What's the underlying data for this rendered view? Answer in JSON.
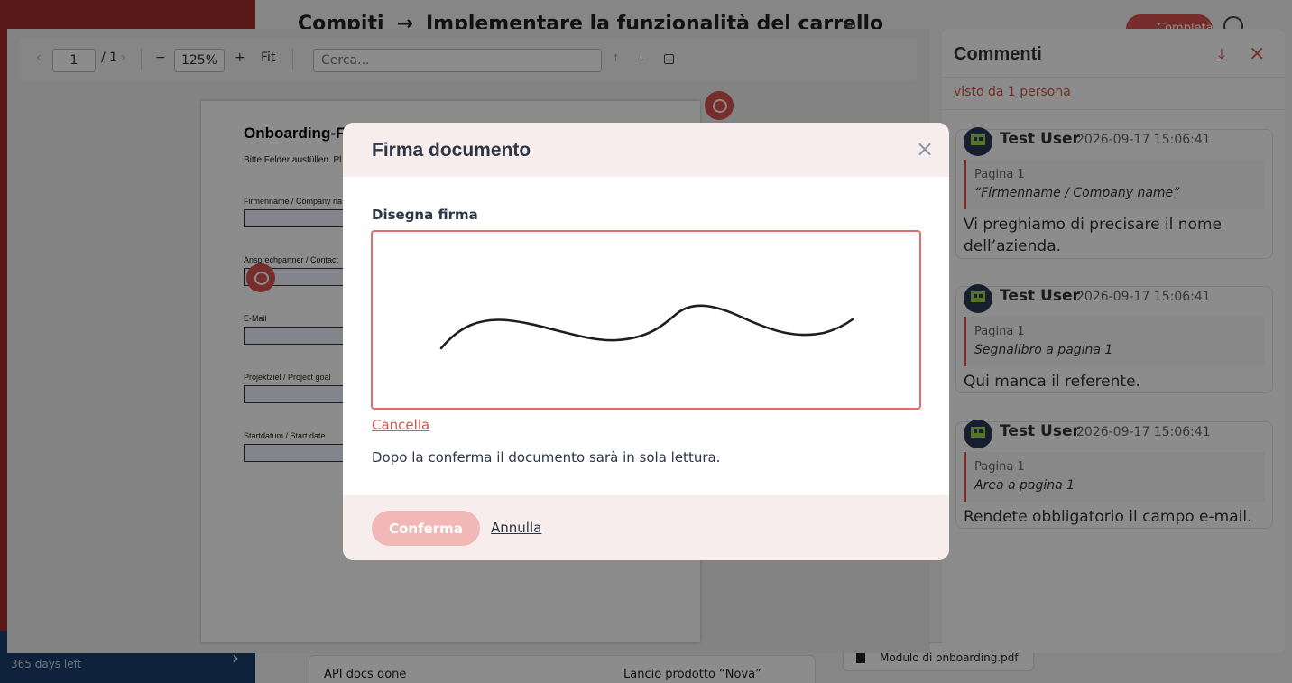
{
  "background": {
    "breadcrumb_parent": "Compiti",
    "breadcrumb_arrow": "→",
    "breadcrumb_current": "Implementare la funzionalità del carrello",
    "complete_label": "Completa",
    "trial_text": "365 days left",
    "task_left": "API docs done",
    "task_right": "Lancio prodotto “Nova”",
    "file_name": "Modulo di onboarding.pdf"
  },
  "toolbar": {
    "prev": "‹",
    "page_value": "1",
    "page_total": "/ 1",
    "next": "›",
    "zoom_out": "−",
    "zoom_value": "125%",
    "zoom_in": "+",
    "fit_label": "Fit",
    "search_placeholder": "Cerca...",
    "search_prev": "↑",
    "search_next": "↓"
  },
  "pdf": {
    "title": "Onboarding-F",
    "subtitle": "Bitte Felder ausfüllen. Pl",
    "fields": [
      {
        "label": "Firmenname / Company na"
      },
      {
        "label": "Ansprechpartner / Contact"
      },
      {
        "label": "E-Mail"
      },
      {
        "label": "Projektziel / Project goal"
      },
      {
        "label": "Startdatum / Start date"
      }
    ]
  },
  "comments": {
    "title": "Commenti",
    "seen_by": "visto da 1 persona",
    "items": [
      {
        "user": "Test User",
        "time": "2026-09-17 15:06:41",
        "page": "Pagina 1",
        "ref": "“Firmenname / Company name”",
        "text": "Vi preghiamo di precisare il nome dell’azienda."
      },
      {
        "user": "Test User",
        "time": "2026-09-17 15:06:41",
        "page": "Pagina 1",
        "ref": "Segnalibro a pagina 1",
        "text": "Qui manca il referente."
      },
      {
        "user": "Test User",
        "time": "2026-09-17 15:06:41",
        "page": "Pagina 1",
        "ref": "Area a pagina 1",
        "text": "Rendete obbligatorio il campo e-mail."
      }
    ]
  },
  "modal": {
    "title": "Firma documento",
    "close": "×",
    "draw_label": "Disegna firma",
    "clear_label": "Cancella",
    "info": "Dopo la conferma il documento sarà in sola lettura.",
    "confirm_label": "Conferma",
    "cancel_label": "Annulla",
    "accent_color": "#d9534f"
  }
}
